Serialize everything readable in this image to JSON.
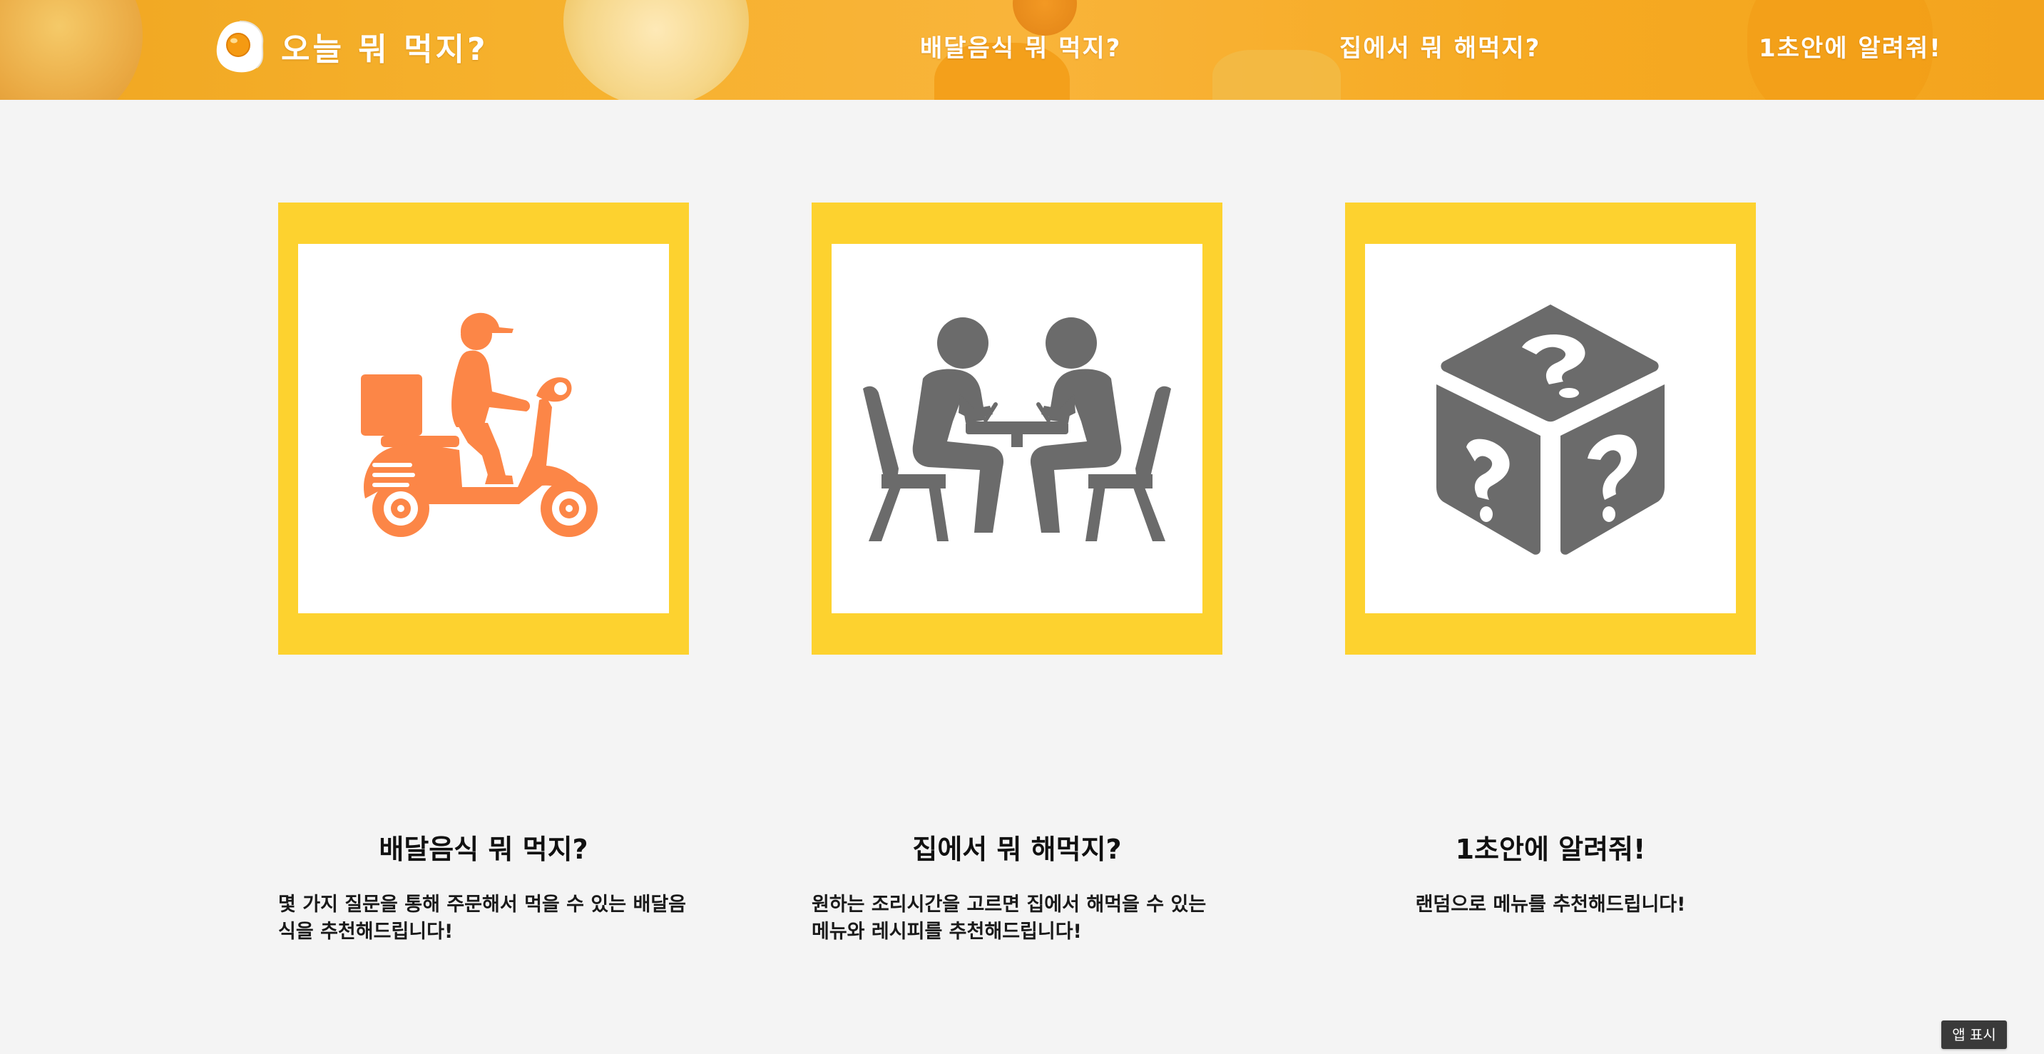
{
  "header": {
    "logo_text": "오늘 뭐 먹지?",
    "logo_icon": "fried-egg-icon",
    "nav": [
      {
        "label": "배달음식 뭐 먹지?"
      },
      {
        "label": "집에서 뭐 해먹지?"
      },
      {
        "label": "1초안에 알려줘!"
      }
    ]
  },
  "cards": [
    {
      "icon": "delivery-scooter-icon",
      "title": "배달음식 뭐 먹지?",
      "description": "몇 가지 질문을 통해 주문해서 먹을 수 있는 배달음식을 추천해드립니다!"
    },
    {
      "icon": "people-at-table-icon",
      "title": "집에서 뭐 해먹지?",
      "description": "원하는 조리시간을 고르면 집에서 해먹을 수 있는 메뉴와 레시피를 추천해드립니다!"
    },
    {
      "icon": "mystery-cube-icon",
      "title": "1초안에 알려줘!",
      "description": "랜덤으로 메뉴를 추천해드립니다!"
    }
  ],
  "app_badge": {
    "label": "앱 표시"
  },
  "colors": {
    "header_orange": "#f6b12c",
    "frame_yellow": "#fdd22f",
    "scooter_orange": "#fc8647",
    "icon_gray": "#6b6b6b",
    "background": "#f4f4f4"
  }
}
